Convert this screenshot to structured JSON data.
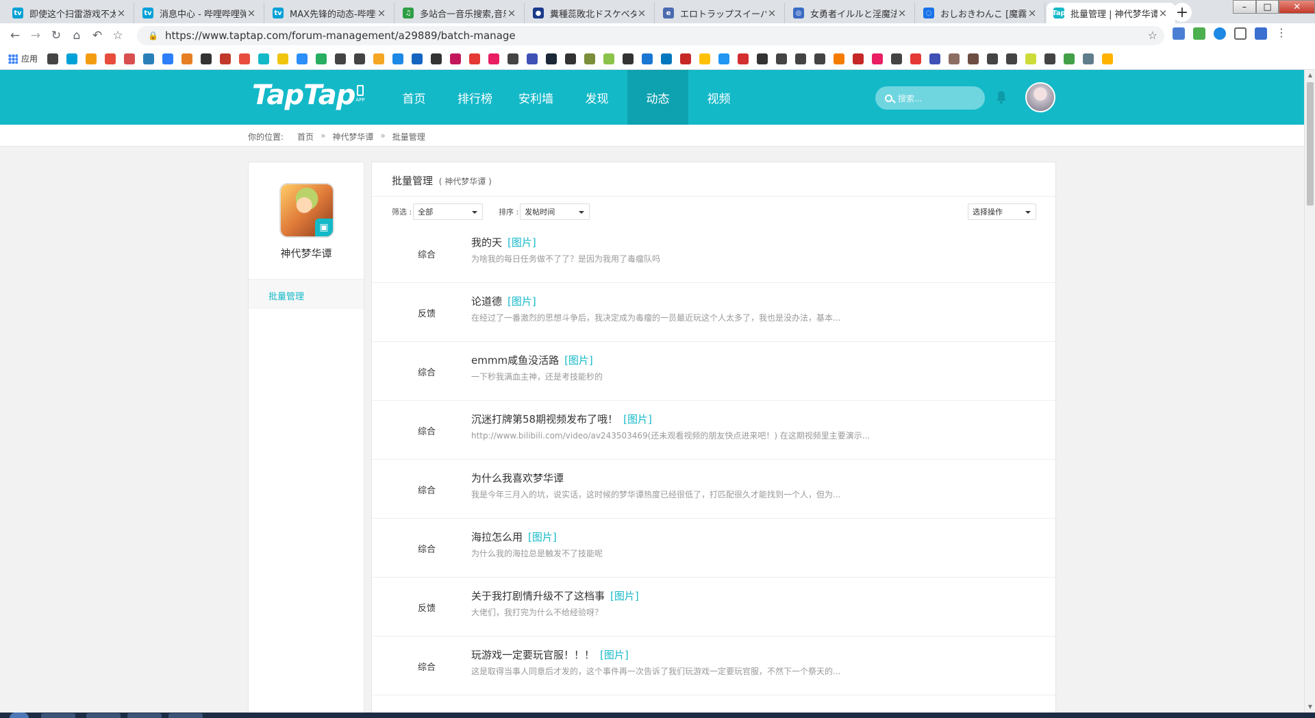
{
  "browser": {
    "tabs": [
      {
        "title": "即使这个扫雷游戏不太正经",
        "fav_color": "#00a1d6",
        "fav": "tv"
      },
      {
        "title": "消息中心 - 哔哩哔哩弹幕",
        "fav_color": "#00a1d6",
        "fav": "tv"
      },
      {
        "title": "MAX先锋的动态-哔哩哔哩",
        "fav_color": "#00a1d6",
        "fav": "tv"
      },
      {
        "title": "多站合一音乐搜索,音乐",
        "fav_color": "#2e9e44",
        "fav": "♫"
      },
      {
        "title": "糞種蕊敗北ドスケベダ",
        "fav_color": "#1a3a8a",
        "fav": "●"
      },
      {
        "title": "エロトラップスイーパ",
        "fav_color": "#4a6ab0",
        "fav": "e"
      },
      {
        "title": "女勇者イルルと淫魔法",
        "fav_color": "#3a6bc4",
        "fav": "◎"
      },
      {
        "title": "おしおきわんこ [魔霧",
        "fav_color": "#1a73e8",
        "fav": "◌"
      },
      {
        "title": "批量管理 | 神代梦华谭",
        "fav_color": "#14b9c8",
        "fav": "Tap",
        "active": true
      }
    ],
    "url": "https://www.taptap.com/forum-management/a29889/batch-manage",
    "bookmarks_apps_label": "应用",
    "bookmark_colors": [
      "#444",
      "#00a1d6",
      "#f39c12",
      "#e74c3c",
      "#d94f4f",
      "#2980b9",
      "#2d7ff9",
      "#e67e22",
      "#333",
      "#c0392b",
      "#e74c3c",
      "#14b9c8",
      "#f1c40f",
      "#2c8ef8",
      "#27ae60",
      "#444",
      "#444",
      "#f5a623",
      "#1e88e5",
      "#1565c0",
      "#333",
      "#c2185b",
      "#e53935",
      "#e91e63",
      "#444",
      "#3f51b5",
      "#1b2838",
      "#333",
      "#7b8e3a",
      "#8bc34a",
      "#333",
      "#1976d2",
      "#0277bd",
      "#c62828",
      "#ffc107",
      "#2196f3",
      "#d32f2f",
      "#333",
      "#444",
      "#444",
      "#444",
      "#f57c00",
      "#c62828",
      "#e91e63",
      "#444",
      "#e53935",
      "#3f51b5",
      "#8d6e63",
      "#6d4c41",
      "#444",
      "#444",
      "#cddc39",
      "#444",
      "#43a047",
      "#607d8b",
      "#ffb300"
    ]
  },
  "site": {
    "logo": "TapTap",
    "app_label": "APP",
    "nav": [
      {
        "label": "首页"
      },
      {
        "label": "排行榜"
      },
      {
        "label": "安利墙"
      },
      {
        "label": "发现"
      },
      {
        "label": "动态",
        "active": true
      },
      {
        "label": "视频"
      }
    ],
    "search_placeholder": "搜索...",
    "breadcrumb": {
      "prefix": "你的位置:",
      "items": [
        "首页",
        "神代梦华谭",
        "批量管理"
      ],
      "sep": "»"
    }
  },
  "sidebar": {
    "game_name": "神代梦华谭",
    "menu": [
      {
        "label": "批量管理",
        "active": true
      }
    ]
  },
  "panel": {
    "title": "批量管理",
    "subtitle": "( 神代梦华谭 )",
    "filter_label": "筛选 :",
    "filter_value": "全部",
    "sort_label": "排序 :",
    "sort_value": "发帖时间",
    "action_value": "选择操作",
    "pic_tag": "[图片]",
    "posts": [
      {
        "category": "综合",
        "title": "我的天",
        "has_pic": true,
        "excerpt": "为啥我的每日任务做不了了？是因为我用了毒瘤队吗"
      },
      {
        "category": "反馈",
        "title": "论道德",
        "has_pic": true,
        "excerpt": "在经过了一番激烈的思想斗争后，我决定成为毒瘤的一员最近玩这个人太多了，我也是没办法，基本..."
      },
      {
        "category": "综合",
        "title": "emmm咸鱼没活路",
        "has_pic": true,
        "excerpt": "一下秒我满血主神，还是考技能秒的"
      },
      {
        "category": "综合",
        "title": "沉迷打牌第58期视频发布了哦！",
        "has_pic": true,
        "excerpt": "http://www.bilibili.com/video/av243503469(还未观看视频的朋友快点进来吧！) 在这期视频里主要演示..."
      },
      {
        "category": "综合",
        "title": "为什么我喜欢梦华谭",
        "has_pic": false,
        "excerpt": "我是今年三月入的坑，说实话，这时候的梦华谭热度已经很低了，打匹配很久才能找到一个人，但为..."
      },
      {
        "category": "综合",
        "title": "海拉怎么用",
        "has_pic": true,
        "excerpt": "为什么我的海拉总是触发不了技能呢"
      },
      {
        "category": "反馈",
        "title": "关于我打剧情升级不了这档事",
        "has_pic": true,
        "excerpt": "大佬们，我打完为什么不给经验呀？"
      },
      {
        "category": "综合",
        "title": "玩游戏一定要玩官服！！！",
        "has_pic": true,
        "excerpt": "这是取得当事人同意后才发的，这个事件再一次告诉了我们玩游戏一定要玩官服，不然下一个祭天的..."
      }
    ]
  }
}
